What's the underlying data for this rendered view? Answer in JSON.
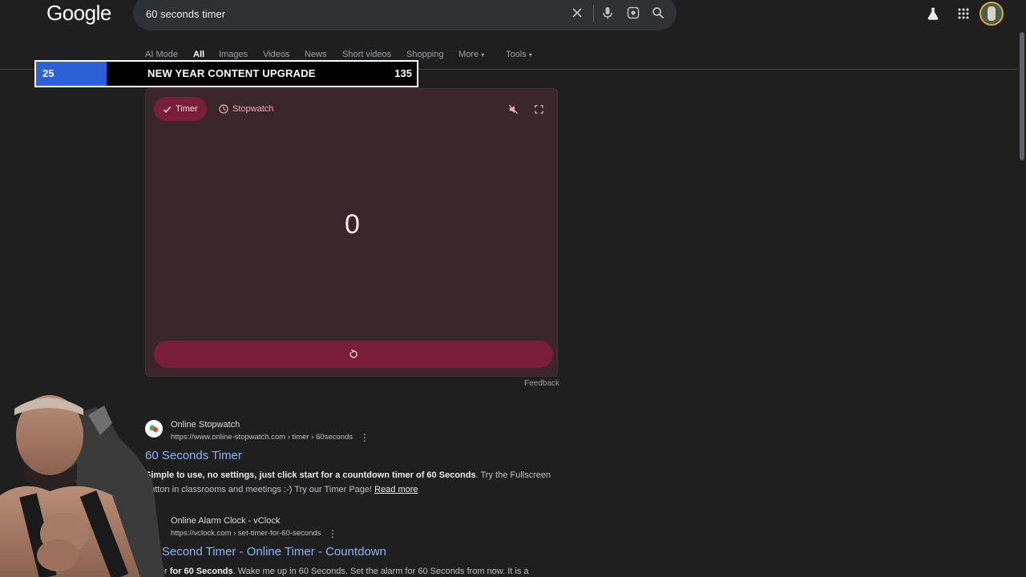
{
  "header": {
    "logo": "Google",
    "search_value": "60 seconds timer"
  },
  "tabs": [
    {
      "label": "AI Mode"
    },
    {
      "label": "All"
    },
    {
      "label": "Images"
    },
    {
      "label": "Videos"
    },
    {
      "label": "News"
    },
    {
      "label": "Short videos"
    },
    {
      "label": "Shopping"
    },
    {
      "label": "More"
    },
    {
      "label": "Tools"
    }
  ],
  "banner": {
    "current": "25",
    "title": "NEW YEAR CONTENT UPGRADE",
    "goal": "135",
    "progress": 0.185
  },
  "timer": {
    "chip_timer": "Timer",
    "chip_stopwatch": "Stopwatch",
    "value": "0",
    "feedback": "Feedback"
  },
  "results": [
    {
      "site": "Online Stopwatch",
      "url": "https://www.online-stopwatch.com › timer › 60seconds",
      "title": "60 Seconds Timer",
      "snippet_bold": "Simple to use, no settings, just click start for a countdown timer of 60 Seconds",
      "snippet_rest": ". Try the Fullscreen button in classrooms and meetings :-) Try our Timer Page! ",
      "read_more": "Read more"
    },
    {
      "site": "Online Alarm Clock - vClock",
      "url": "https://vclock.com › set-timer-for-60-seconds",
      "title": "60 Second Timer - Online Timer - Countdown",
      "snippet_prefix": "Timer ",
      "snippet_bold": "for 60 Seconds",
      "snippet_rest": ". Wake me up in 60 Seconds. Set the alarm for 60 Seconds from now. It is a"
    }
  ],
  "colors": {
    "accent": "#7a1e3c",
    "card_bg": "#3a262b",
    "link": "#8ab4f8",
    "banner_fill": "#2c5fd8"
  }
}
